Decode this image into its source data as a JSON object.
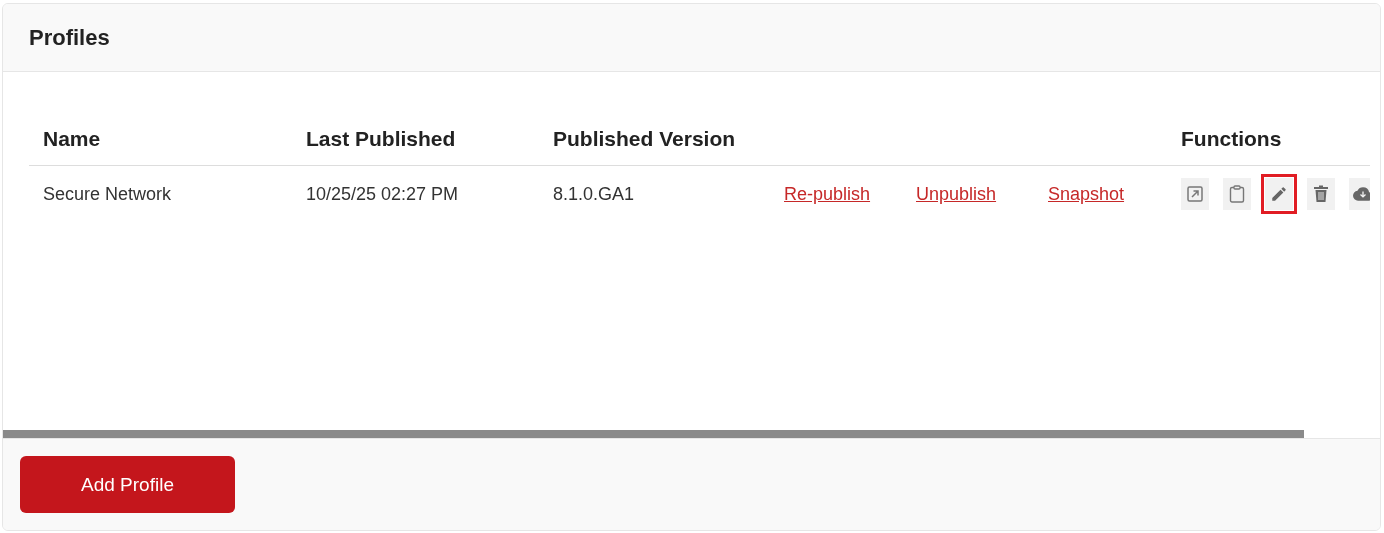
{
  "panel": {
    "title": "Profiles"
  },
  "table": {
    "columns": [
      "Name",
      "Last Published",
      "Published Version",
      "Functions"
    ],
    "rows": [
      {
        "name": "Secure Network",
        "last_published": "10/25/25 02:27 PM",
        "published_version": "8.1.0.GA1",
        "links": [
          "Re-publish",
          "Unpublish",
          "Snapshot"
        ],
        "functions": [
          {
            "kind": "open",
            "highlighted": false
          },
          {
            "kind": "clipboard",
            "highlighted": false
          },
          {
            "kind": "edit",
            "highlighted": true
          },
          {
            "kind": "delete",
            "highlighted": false
          },
          {
            "kind": "download",
            "highlighted": false
          }
        ]
      }
    ]
  },
  "footer": {
    "button": "Add Profile"
  }
}
